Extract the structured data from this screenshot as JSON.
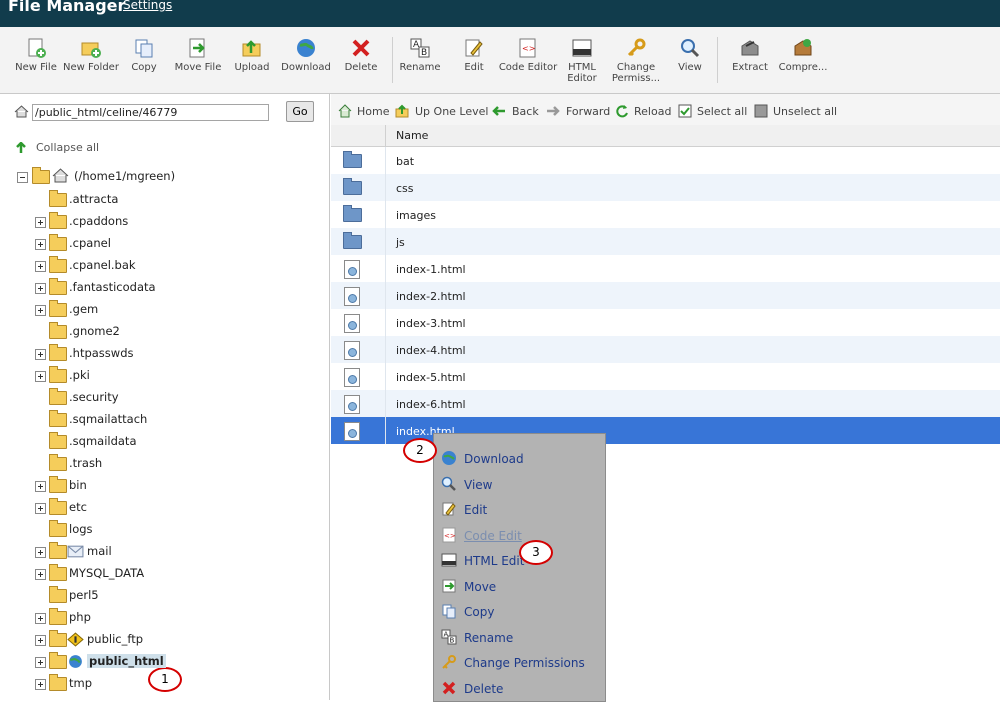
{
  "header": {
    "title": "File Manager",
    "settings_link": "Settings"
  },
  "toolbar": {
    "items": [
      {
        "label": "New File",
        "icon": "new-file-icon"
      },
      {
        "label": "New Folder",
        "icon": "new-folder-icon"
      },
      {
        "label": "Copy",
        "icon": "copy-icon"
      },
      {
        "label": "Move File",
        "icon": "move-file-icon"
      },
      {
        "label": "Upload",
        "icon": "upload-icon"
      },
      {
        "label": "Download",
        "icon": "download-icon"
      },
      {
        "label": "Delete",
        "icon": "delete-icon"
      },
      {
        "label": "Rename",
        "icon": "rename-icon"
      },
      {
        "label": "Edit",
        "icon": "edit-icon"
      },
      {
        "label": "Code Editor",
        "icon": "code-editor-icon"
      },
      {
        "label": "HTML Editor",
        "icon": "html-editor-icon"
      },
      {
        "label": "Change Permiss...",
        "icon": "key-icon"
      },
      {
        "label": "View",
        "icon": "magnifier-icon"
      },
      {
        "label": "Extract",
        "icon": "extract-icon"
      },
      {
        "label": "Compre...",
        "icon": "compress-icon"
      }
    ]
  },
  "pathbar": {
    "value": "/public_html/celine/46779",
    "go_label": "Go"
  },
  "tree": {
    "collapse_label": "Collapse all",
    "root_label": "(/home1/mgreen)",
    "items": [
      {
        "label": ".attracta"
      },
      {
        "label": ".cpaddons"
      },
      {
        "label": ".cpanel"
      },
      {
        "label": ".cpanel.bak"
      },
      {
        "label": ".fantasticodata"
      },
      {
        "label": ".gem"
      },
      {
        "label": ".gnome2"
      },
      {
        "label": ".htpasswds"
      },
      {
        "label": ".pki"
      },
      {
        "label": ".security"
      },
      {
        "label": ".sqmailattach"
      },
      {
        "label": ".sqmaildata"
      },
      {
        "label": ".trash"
      },
      {
        "label": "bin"
      },
      {
        "label": "etc"
      },
      {
        "label": "logs"
      },
      {
        "label": "mail"
      },
      {
        "label": "MYSQL_DATA"
      },
      {
        "label": "perl5"
      },
      {
        "label": "php"
      },
      {
        "label": "public_ftp"
      },
      {
        "label": "public_html"
      },
      {
        "label": "tmp"
      }
    ]
  },
  "nav": {
    "home": "Home",
    "up": "Up One Level",
    "back": "Back",
    "forward": "Forward",
    "reload": "Reload",
    "select_all": "Select all",
    "unselect_all": "Unselect all"
  },
  "grid": {
    "column_name": "Name",
    "rows": [
      {
        "name": "bat",
        "type": "folder"
      },
      {
        "name": "css",
        "type": "folder"
      },
      {
        "name": "images",
        "type": "folder"
      },
      {
        "name": "js",
        "type": "folder"
      },
      {
        "name": "index-1.html",
        "type": "file"
      },
      {
        "name": "index-2.html",
        "type": "file"
      },
      {
        "name": "index-3.html",
        "type": "file"
      },
      {
        "name": "index-4.html",
        "type": "file"
      },
      {
        "name": "index-5.html",
        "type": "file"
      },
      {
        "name": "index-6.html",
        "type": "file"
      },
      {
        "name": "index.html",
        "type": "file",
        "selected": true
      }
    ]
  },
  "context_menu": {
    "items": [
      {
        "label": "Download",
        "icon": "globe-download-icon"
      },
      {
        "label": "View",
        "icon": "magnifier-icon"
      },
      {
        "label": "Edit",
        "icon": "edit-icon"
      },
      {
        "label": "Code Edit",
        "icon": "code-editor-icon",
        "disabled": true
      },
      {
        "label": "HTML Edit",
        "icon": "html-editor-icon"
      },
      {
        "label": "Move",
        "icon": "move-icon"
      },
      {
        "label": "Copy",
        "icon": "copy-icon"
      },
      {
        "label": "Rename",
        "icon": "rename-icon"
      },
      {
        "label": "Change Permissions",
        "icon": "key-icon"
      },
      {
        "label": "Delete",
        "icon": "delete-icon"
      }
    ]
  },
  "callouts": [
    "1",
    "2",
    "3"
  ],
  "colors": {
    "header": "#113c4c",
    "selection": "#3875d7",
    "menu_bg": "#b3b3b3",
    "callout": "#d40000"
  }
}
